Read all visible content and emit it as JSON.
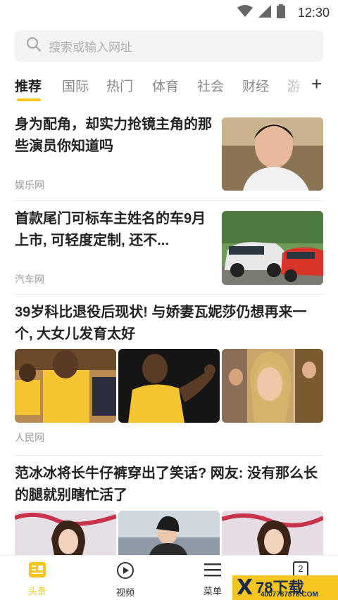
{
  "status_bar": {
    "time": "12:30"
  },
  "search": {
    "placeholder": "搜索或输入网址"
  },
  "tabs": [
    {
      "label": "推荐"
    },
    {
      "label": "国际"
    },
    {
      "label": "热门"
    },
    {
      "label": "体育"
    },
    {
      "label": "社会"
    },
    {
      "label": "财经"
    },
    {
      "label": "游"
    }
  ],
  "tab_add_label": "+",
  "articles": [
    {
      "title": "身为配角，却实力抢镜主角的那些演员你知道吗",
      "source": "娱乐网"
    },
    {
      "title": "首款尾门可标车主姓名的车9月上市, 可轻度定制, 还不...",
      "source": "汽车网"
    },
    {
      "title": "39岁科比退役后现状! 与娇妻瓦妮莎仍想再来一个, 大女儿发育太好",
      "source": "人民网"
    },
    {
      "title": "范冰冰将长牛仔裤穿出了笑话? 网友: 没有那么长的腿就别瞎忙活了",
      "source": ""
    }
  ],
  "bottom_nav": [
    {
      "label": "头条",
      "icon": "headline-icon"
    },
    {
      "label": "视频",
      "icon": "play-icon"
    },
    {
      "label": "菜单",
      "icon": "menu-icon"
    },
    {
      "label": "2",
      "icon": "tabs-count-icon"
    }
  ],
  "watermark": {
    "mark": "X",
    "main": "78下载",
    "url": "4007787878.COM"
  },
  "colors": {
    "accent": "#f7c520"
  }
}
